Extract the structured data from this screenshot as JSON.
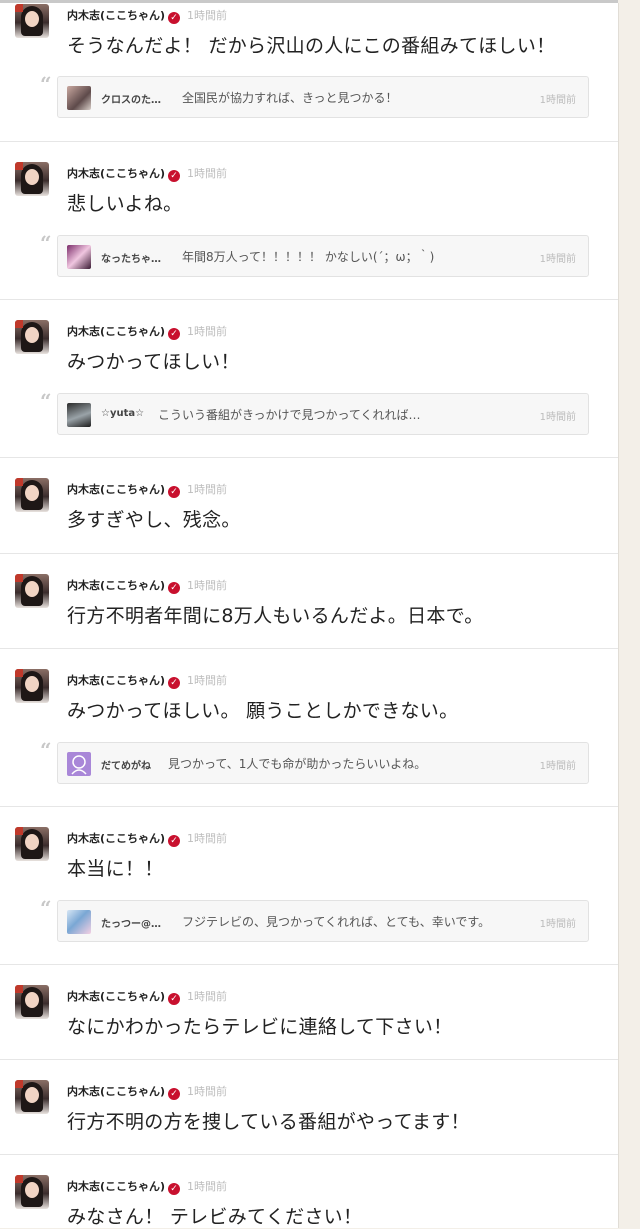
{
  "author": {
    "name": "内木志(ここちゃん)",
    "verified_icon": "verified-check-icon",
    "verified_color": "#c8102e"
  },
  "posts": [
    {
      "time": "1時間前",
      "text": "そうなんだよ！ だから沢山の人にこの番組みてほしい！",
      "quote": {
        "name": "クロスのた…",
        "text": "全国民が協力すれば、きっと見つかる！",
        "time": "1時間前"
      }
    },
    {
      "time": "1時間前",
      "text": "悲しいよね。",
      "quote": {
        "name": "なったちゃ…",
        "text": "年間8万人って！！！！！ かなしい(´；ω；｀)",
        "time": "1時間前"
      }
    },
    {
      "time": "1時間前",
      "text": "みつかってほしい！",
      "quote": {
        "name": "☆yuta☆",
        "text": "こういう番組がきっかけで見つかってくれれば…",
        "time": "1時間前"
      }
    },
    {
      "time": "1時間前",
      "text": "多すぎやし、残念。"
    },
    {
      "time": "1時間前",
      "text": "行方不明者年間に8万人もいるんだよ。日本で。"
    },
    {
      "time": "1時間前",
      "text": "みつかってほしい。 願うことしかできない。",
      "quote": {
        "name": "だてめがね",
        "text": "見つかって、1人でも命が助かったらいいよね。",
        "time": "1時間前"
      }
    },
    {
      "time": "1時間前",
      "text": "本当に！！",
      "quote": {
        "name": "たっつー@…",
        "text": "フジテレビの、見つかってくれれば、とても、幸いです。",
        "time": "1時間前"
      }
    },
    {
      "time": "1時間前",
      "text": "なにかわかったらテレビに連絡して下さい！"
    },
    {
      "time": "1時間前",
      "text": "行方不明の方を捜している番組がやってます！"
    },
    {
      "time": "1時間前",
      "text": "みなさん！ テレビみてください！"
    }
  ],
  "icons": {
    "quote": "quote-mark-icon",
    "avatar": "avatar"
  }
}
